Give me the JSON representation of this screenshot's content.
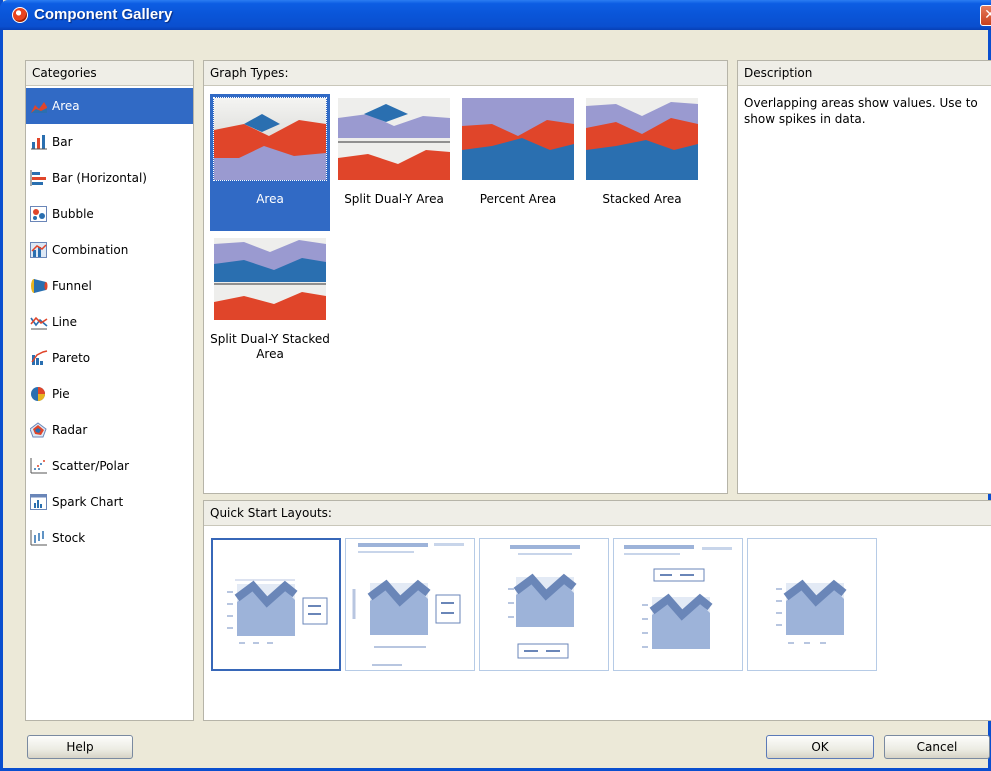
{
  "window": {
    "title": "Component Gallery",
    "close_glyph": "✕",
    "app_icon": "app-logo-icon"
  },
  "categories": {
    "header": "Categories",
    "items": [
      {
        "label": "Area",
        "icon": "area-icon"
      },
      {
        "label": "Bar",
        "icon": "bar-icon"
      },
      {
        "label": "Bar (Horizontal)",
        "icon": "bar-horizontal-icon"
      },
      {
        "label": "Bubble",
        "icon": "bubble-icon"
      },
      {
        "label": "Combination",
        "icon": "combination-icon"
      },
      {
        "label": "Funnel",
        "icon": "funnel-icon"
      },
      {
        "label": "Line",
        "icon": "line-icon"
      },
      {
        "label": "Pareto",
        "icon": "pareto-icon"
      },
      {
        "label": "Pie",
        "icon": "pie-icon"
      },
      {
        "label": "Radar",
        "icon": "radar-icon"
      },
      {
        "label": "Scatter/Polar",
        "icon": "scatter-icon"
      },
      {
        "label": "Spark Chart",
        "icon": "spark-chart-icon"
      },
      {
        "label": "Stock",
        "icon": "stock-icon"
      }
    ],
    "selected": "Area"
  },
  "graph_types": {
    "header": "Graph Types:",
    "items": [
      {
        "label": "Area"
      },
      {
        "label": "Split Dual-Y Area"
      },
      {
        "label": "Percent Area"
      },
      {
        "label": "Stacked Area"
      },
      {
        "label": "Split Dual-Y Stacked Area"
      }
    ],
    "selected": "Area"
  },
  "description": {
    "header": "Description",
    "text": "Overlapping areas show values. Use to show spikes in data."
  },
  "quick_start": {
    "header": "Quick Start Layouts:",
    "count": 5,
    "selected_index": 0
  },
  "buttons": {
    "help": "Help",
    "ok": "OK",
    "cancel": "Cancel"
  },
  "colors": {
    "selection": "#316ac5",
    "titlebar": "#0a55d8",
    "area_red": "#e0452a",
    "area_blue": "#2a6fb0",
    "area_purple": "#9a9ad0"
  }
}
